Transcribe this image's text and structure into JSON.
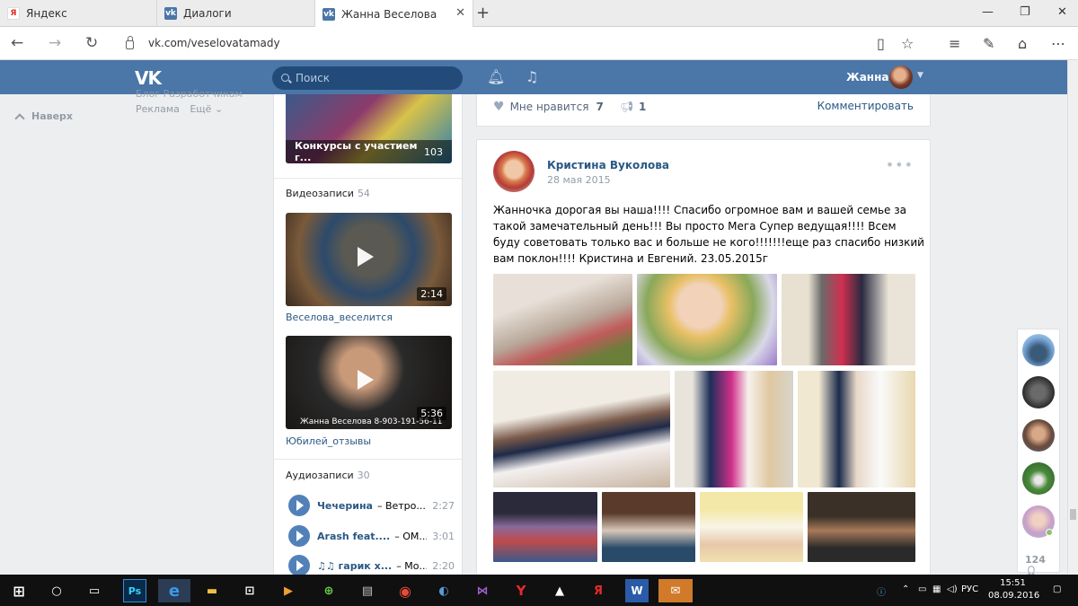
{
  "browser": {
    "tabs": [
      {
        "title": "Яндекс",
        "favicon": "Я",
        "color": "#e52620"
      },
      {
        "title": "Диалоги",
        "favicon": "vk",
        "color": "#4a76a8"
      },
      {
        "title": "Жанна Веселова",
        "favicon": "vk",
        "color": "#4a76a8",
        "active": true
      }
    ],
    "new_tab": "+",
    "url": "vk.com/veselovatamady",
    "icons": [
      "back-arrow-icon",
      "forward-arrow-icon",
      "refresh-icon",
      "reading-view-icon",
      "favorite-star-icon",
      "hub-icon",
      "web-note-icon",
      "share-icon",
      "more-icon"
    ]
  },
  "vk_header": {
    "logo": "VK",
    "search_placeholder": "Поиск",
    "user_name": "Жанна"
  },
  "left_nav": {
    "up_label": "Наверх",
    "links_top": "Блог   Разработчикам",
    "ads": "Реклама",
    "more": "Ещё"
  },
  "sidebar": {
    "album_caption": "Конкурсы с участием г...",
    "album_count": "103",
    "videos_title": "Видеозаписи",
    "videos_count": "54",
    "videos": [
      {
        "title": "Веселова_веселится",
        "duration": "2:14"
      },
      {
        "title": "Юбилей_отзывы",
        "duration": "5:36",
        "watermark": "Жанна Веселова   8-903-191-56-11"
      }
    ],
    "audio_title": "Аудиозаписи",
    "audio_count": "30",
    "audios": [
      {
        "artist": "Чечерина",
        "title": "– Ветро...",
        "duration": "2:27"
      },
      {
        "artist": "Arash feat....",
        "title": "– OM...",
        "duration": "3:01"
      },
      {
        "artist": "♫♫ гарик х...",
        "title": "– Мо...",
        "duration": "2:20"
      }
    ]
  },
  "prev_post": {
    "like_label": "Мне нравится",
    "likes": "7",
    "shares": "1",
    "comment_label": "Комментировать"
  },
  "post": {
    "author": "Кристина Вуколова",
    "date": "28 мая 2015",
    "text": "Жанночка дорогая вы наша!!!! Спасибо огромное вам и вашей семье за такой замечательный день!!! Вы просто Мега Супер ведущая!!!! Всем буду советовать только вас и больше не кого!!!!!!!еще раз спасибо низкий вам поклон!!!! Кристина и Евгений. 23.05.2015г"
  },
  "friends_count": "124",
  "taskbar": {
    "lang": "РУС",
    "time": "15:51",
    "date": "08.09.2016"
  }
}
